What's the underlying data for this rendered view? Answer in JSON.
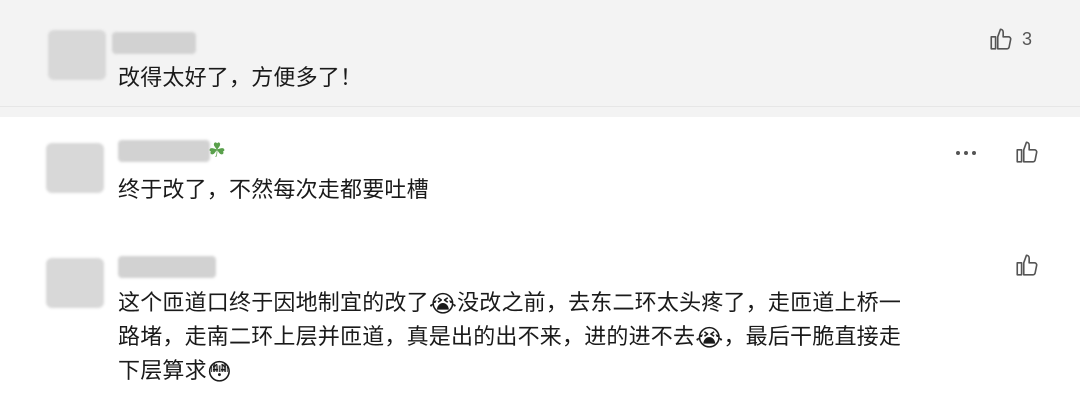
{
  "comments": [
    {
      "text": "改得太好了，方便多了！",
      "likes": "3"
    },
    {
      "text": "终于改了，不然每次走都要吐槽"
    },
    {
      "lines": [
        {
          "before": "这个匝道口终于因地制宜的改了",
          "emoji": "😭",
          "after": "没改之前，去东二环太头疼了，走匝道上桥一"
        },
        {
          "before": "路堵，走南二环上层并匝道，真是出的出不来，进的进不去",
          "emoji": "😭",
          "after": "，最后干脆直接走"
        },
        {
          "before": "下层算求",
          "emoji": "😳",
          "after": ""
        }
      ]
    }
  ],
  "icons": {
    "like": "thumbs-up-icon",
    "more": "more-dots-icon",
    "clover": "clover-icon"
  },
  "colors": {
    "band": "#f3f3f3",
    "icon": "#555555"
  }
}
